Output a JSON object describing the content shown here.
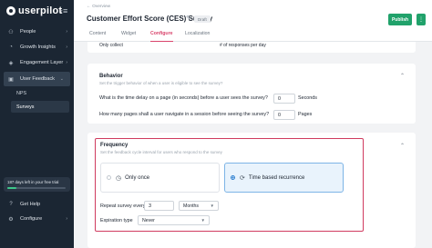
{
  "sidebar": {
    "logo_text": "userpilot",
    "collapse_icon": "collapse-icon",
    "items": [
      {
        "label": "People",
        "icon": "people-icon"
      },
      {
        "label": "Growth Insights",
        "icon": "insights-icon"
      },
      {
        "label": "Engagement Layer",
        "icon": "layers-icon"
      },
      {
        "label": "User Feedback",
        "icon": "feedback-icon"
      }
    ],
    "sub_items": [
      {
        "label": "NPS"
      },
      {
        "label": "Surveys"
      }
    ],
    "trial_text": "187 days left in your free trial",
    "trial_progress": 0.15,
    "bottom_items": [
      {
        "label": "Get Help",
        "icon": "help-icon"
      },
      {
        "label": "Configure",
        "icon": "gear-icon"
      }
    ]
  },
  "header": {
    "back_label": "← Overview",
    "title": "Customer Effort Score (CES) Survey",
    "badge": "Draft",
    "publish_label": "Publish",
    "tabs": [
      {
        "label": "Content"
      },
      {
        "label": "Widget"
      },
      {
        "label": "Configure"
      },
      {
        "label": "Localization"
      }
    ]
  },
  "partial_row": {
    "left": "Only collect",
    "right": "# of responses per day"
  },
  "behavior": {
    "title": "Behavior",
    "subtitle": "Set the trigger behavior of when a user is eligible to see the survey?",
    "q1_label": "What is the time delay on a page (in seconds) before a user sees the survey?",
    "q1_value": "0",
    "q1_unit": "Seconds",
    "q2_label": "How many pages shall a user navigate in a session before seeing the survey?",
    "q2_value": "0",
    "q2_unit": "Pages"
  },
  "frequency": {
    "title": "Frequency",
    "subtitle": "Set the feedback cycle interval for users who respond to the survey",
    "option1": "Only once",
    "option2": "Time based recurrence",
    "repeat_label": "Repeat survey every",
    "repeat_value": "3",
    "repeat_unit": "Months",
    "expiration_label": "Expiration type",
    "expiration_value": "Never"
  },
  "colors": {
    "accent": "#d9446c",
    "publish": "#21a26b",
    "sidebar": "#1b2633"
  }
}
